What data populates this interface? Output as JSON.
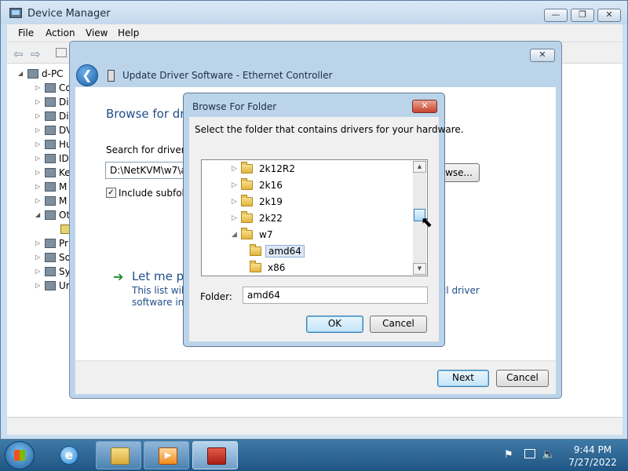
{
  "device_manager": {
    "title": "Device Manager",
    "caption_buttons": {
      "minimize": "—",
      "maximize": "❐",
      "close": "✕"
    },
    "menu": [
      "File",
      "Action",
      "View",
      "Help"
    ],
    "tree_root": "d-PC",
    "tree_items": [
      "Co",
      "Di",
      "Di",
      "DV",
      "Hu",
      "ID",
      "Ke",
      "M",
      "M",
      "Ot",
      "",
      "Pr",
      "So",
      "Sy",
      "Ur"
    ]
  },
  "wizard": {
    "title": "Update Driver Software - Ethernet Controller",
    "close": "✕",
    "heading": "Browse for dri",
    "search_label": "Search for driver so",
    "path_value": "D:\\NetKVM\\w7\\an",
    "browse_label": "wse...",
    "include_subfolders": "Include subfold",
    "include_checked": "✓",
    "let_me_pick": "Let me pi",
    "desc_line1": "This list will s",
    "desc_line2": "software in t",
    "desc_tail1": "ll driver",
    "next_label": "Next",
    "cancel_label": "Cancel"
  },
  "browse_dialog": {
    "title": "Browse For Folder",
    "close": "✕",
    "instruction": "Select the folder that contains drivers for your hardware.",
    "folders": [
      {
        "name": "2k12R2",
        "expander": "▷"
      },
      {
        "name": "2k16",
        "expander": "▷"
      },
      {
        "name": "2k19",
        "expander": "▷"
      },
      {
        "name": "2k22",
        "expander": "▷"
      },
      {
        "name": "w7",
        "expander": "◢"
      },
      {
        "name": "amd64",
        "expander": ""
      },
      {
        "name": "x86",
        "expander": ""
      }
    ],
    "selected_folder": "amd64",
    "folder_label": "Folder:",
    "folder_value": "amd64",
    "ok_label": "OK",
    "cancel_label": "Cancel"
  },
  "taskbar": {
    "time": "9:44 PM",
    "date": "7/27/2022"
  },
  "icons": {
    "start": "windows-start-icon",
    "ie": "internet-explorer-icon",
    "explorer": "folder-icon",
    "media": "media-player-icon",
    "toolbox": "toolbox-icon"
  }
}
